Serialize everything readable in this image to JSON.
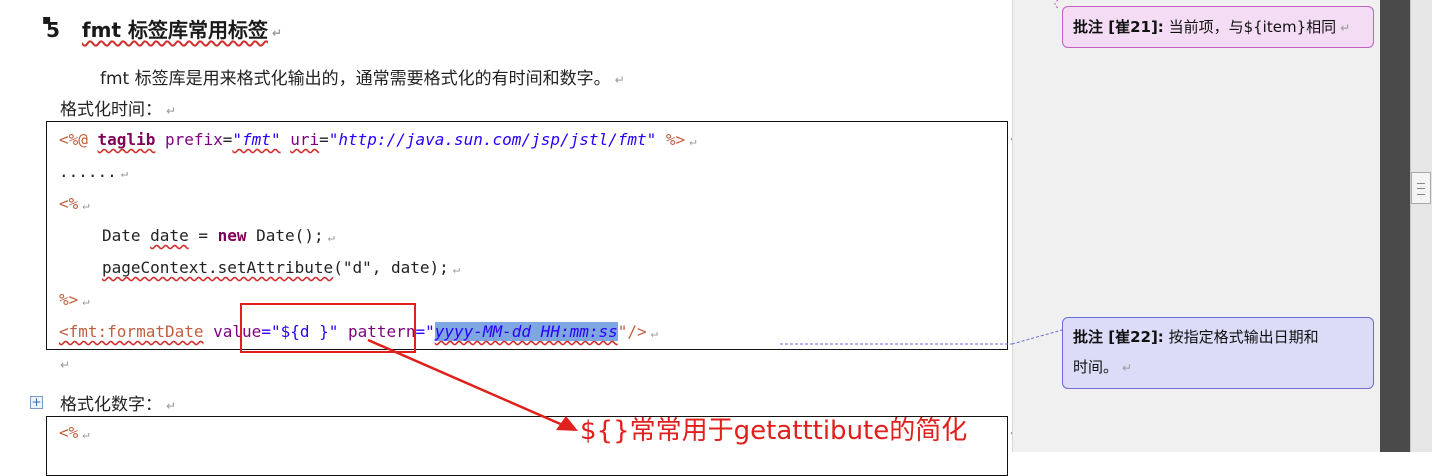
{
  "document": {
    "heading": {
      "number": "5",
      "title": "fmt 标签库常用标签"
    },
    "intro": "fmt 标签库是用来格式化输出的，通常需要格式化的有时间和数字。",
    "label_time": "格式化时间：",
    "label_number": "格式化数字：",
    "code_time": {
      "line1": {
        "open": "<%@ ",
        "kw": "taglib",
        "a1": "prefix",
        "v1": "\"fmt\"",
        "a2": "uri",
        "v2": "\"http://java.sun.com/jsp/jstl/fmt\"",
        "close": " %>"
      },
      "line2": "......",
      "line3": "<%",
      "line4": {
        "type": "Date",
        "var": "date",
        "eq": " = ",
        "kw": "new",
        "rest": " Date();"
      },
      "line5": {
        "obj": "pageContext.setAttribute",
        "p1": "(\"d\", date);"
      },
      "line6": "%>",
      "line7": {
        "tag": "<fmt:formatDate",
        "a1": "value",
        "v1": "=\"${d }\"",
        "a2": "pattern",
        "q1": "=\"",
        "v2": "yyyy-MM-dd HH:mm:ss",
        "q2": "\"/>"
      }
    },
    "code_number": {
      "line1": "<%"
    },
    "annotation": "${}常常用于getatttibute的简化"
  },
  "comments": [
    {
      "label": "批注 [崔21]:",
      "text": "当前项，与${item}相同"
    },
    {
      "label": "批注 [崔22]:",
      "text_line1": "按指定格式输出日期和",
      "text_line2": "时间。"
    }
  ],
  "colors": {
    "annotation_red": "#e0201c",
    "highlight": "#7ea6e0",
    "balloon1": "#f4dcf4",
    "balloon2": "#dcdcf8"
  }
}
